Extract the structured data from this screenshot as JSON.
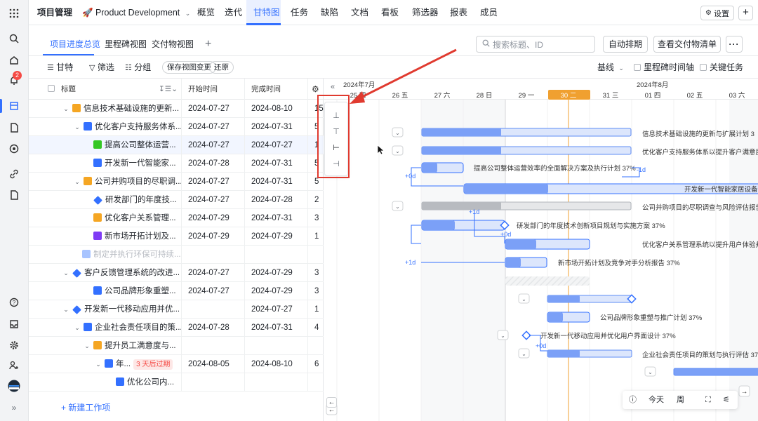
{
  "topbar": {
    "title": "项目管理",
    "project": "🚀 Product Development",
    "nav": [
      "概览",
      "迭代",
      "甘特图",
      "任务",
      "缺陷",
      "文档",
      "看板",
      "筛选器",
      "报表",
      "成员"
    ],
    "settings": "设置"
  },
  "tabs": {
    "items": [
      "项目进度总览",
      "里程碑视图",
      "交付物视图"
    ],
    "search_placeholder": "搜索标题、ID",
    "auto_schedule": "自动排期",
    "view_deliverables": "查看交付物清单"
  },
  "toolbar": {
    "gantt": "甘特",
    "filter": "筛选",
    "group": "分组",
    "save_view": "保存视图变更",
    "restore": "还原",
    "baseline": "基线",
    "milestone_axis": "里程碑时间轴",
    "critical_task": "关键任务"
  },
  "table": {
    "headers": {
      "title": "标题",
      "start": "开始时间",
      "end": "完成时间"
    },
    "rows": [
      {
        "name": "信息技术基础设施的更新...",
        "start": "2024-07-27",
        "end": "2024-08-10",
        "dur": "15"
      },
      {
        "name": "优化客户支持服务体系...",
        "start": "2024-07-27",
        "end": "2024-07-31",
        "dur": "5"
      },
      {
        "name": "提高公司整体运营...",
        "start": "2024-07-27",
        "end": "2024-07-27",
        "dur": "1"
      },
      {
        "name": "开发新一代智能家...",
        "start": "2024-07-28",
        "end": "2024-07-31",
        "dur": "5"
      },
      {
        "name": "公司并购项目的尽职调...",
        "start": "2024-07-27",
        "end": "2024-07-31",
        "dur": "5"
      },
      {
        "name": "研发部门的年度技...",
        "start": "2024-07-27",
        "end": "2024-07-28",
        "dur": "2"
      },
      {
        "name": "优化客户关系管理...",
        "start": "2024-07-29",
        "end": "2024-07-31",
        "dur": "3"
      },
      {
        "name": "新市场开拓计划及...",
        "start": "2024-07-29",
        "end": "2024-07-29",
        "dur": "1"
      },
      {
        "name": "制定并执行环保可持续...",
        "start": "",
        "end": "",
        "dur": ""
      },
      {
        "name": "客户反馈管理系统的改进...",
        "start": "2024-07-27",
        "end": "2024-07-29",
        "dur": "3"
      },
      {
        "name": "公司品牌形象重塑...",
        "start": "2024-07-27",
        "end": "2024-07-29",
        "dur": "3"
      },
      {
        "name": "开发新一代移动应用并优...",
        "start": "",
        "end": "2024-07-27",
        "dur": "1"
      },
      {
        "name": "企业社会责任项目的策...",
        "start": "2024-07-28",
        "end": "2024-07-31",
        "dur": "4"
      },
      {
        "name": "提升员工满意度与...",
        "start": "",
        "end": "",
        "dur": ""
      },
      {
        "name": "年...",
        "tag": "3 天后过期",
        "start": "2024-08-05",
        "end": "2024-08-10",
        "dur": "6"
      },
      {
        "name": "优化公司内...",
        "start": "",
        "end": "",
        "dur": ""
      }
    ],
    "new_item": "+ 新建工作项"
  },
  "gantt": {
    "month_july": "2024年7月",
    "month_aug": "2024年8月",
    "days": [
      "25 四",
      "26 五",
      "27 六",
      "28 日",
      "29 一",
      "30 二",
      "31 三",
      "01 四",
      "02 五",
      "03 六"
    ],
    "labels": {
      "r0": "信息技术基础设施的更新与扩展计划  3",
      "r1": "优化客户支持服务体系以提升客户满意度",
      "r2": "提高公司整体运营效率的全面解决方案及执行计划  37%",
      "r3": "开发新一代智能家居设备",
      "r4": "公司并购项目的尽职调查与风险评估报告",
      "r5": "研发部门的年度技术创新项目规划与实施方案  37%",
      "r6": "优化客户关系管理系统以提升用户体验并",
      "r7": "新市场开拓计划及竞争对手分析报告  37%",
      "r10": "公司品牌形象重塑与推广计划  37%",
      "r11": "开发新一代移动应用并优化用户界面设计  37%",
      "r12": "企业社会责任项目的策划与执行评估  37%"
    },
    "lags": {
      "a": "+0d",
      "b": "-1d",
      "c": "+1d",
      "d": "+0d",
      "e": "+1d",
      "f": "+0d"
    }
  },
  "zoom": {
    "today": "今天",
    "scale": "周"
  }
}
